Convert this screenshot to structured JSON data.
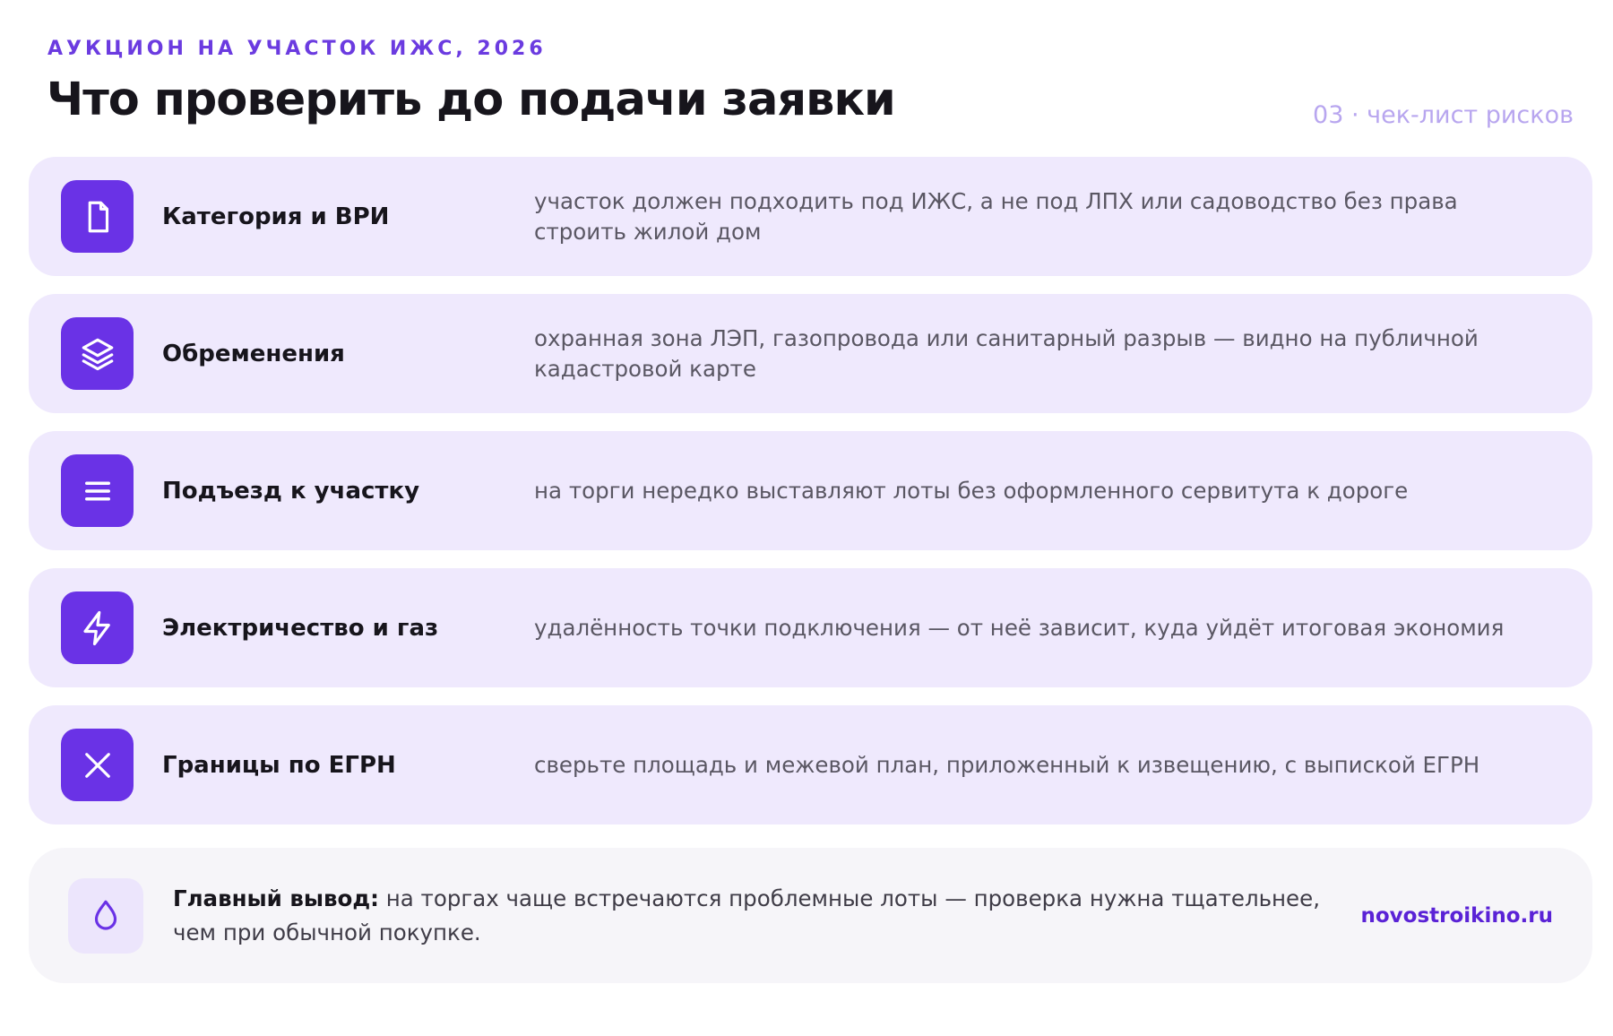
{
  "header": {
    "kicker": "АУКЦИОН НА УЧАСТОК ИЖС, 2026",
    "title": "Что проверить до подачи заявки",
    "subtitle": "03 · чек-лист рисков"
  },
  "checklist": [
    {
      "icon": "document-icon",
      "label": "Категория и ВРИ",
      "description": "участок должен подходить под ИЖС, а не под ЛПХ или садоводство без права строить жилой дом"
    },
    {
      "icon": "layers-icon",
      "label": "Обременения",
      "description": "охранная зона ЛЭП, газопровода или санитарный разрыв — видно на публичной кадастровой карте"
    },
    {
      "icon": "menu-lines-icon",
      "label": "Подъезд к участку",
      "description": "на торги нередко выставляют лоты без оформленного сервитута к дороге"
    },
    {
      "icon": "lightning-icon",
      "label": "Электричество и газ",
      "description": "удалённость точки подключения — от неё зависит, куда уйдёт итоговая экономия"
    },
    {
      "icon": "close-x-icon",
      "label": "Границы по ЕГРН",
      "description": "сверьте площадь и межевой план, приложенный к извещению, с выпиской ЕГРН"
    }
  ],
  "summary": {
    "icon": "drop-icon",
    "label": "Главный вывод:",
    "text": " на торгах чаще встречаются проблемные лоты — проверка нужна тщательнее, чем при обычной покупке.",
    "site": "novostroikino.ru"
  },
  "colors": {
    "accent": "#6a32e6",
    "row_background": "#efe9fd",
    "summary_background": "#f6f5f9",
    "kicker": "#6b3be0",
    "subtitle": "#b8a6ef"
  }
}
